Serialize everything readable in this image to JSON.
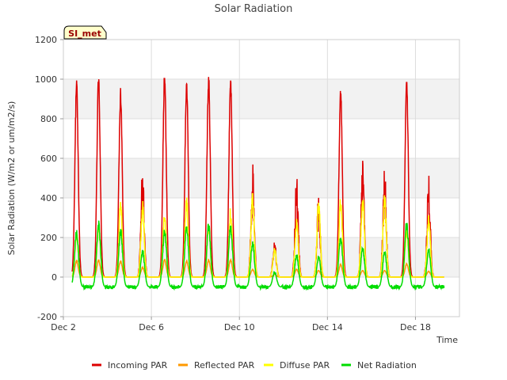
{
  "chart_data": {
    "type": "line",
    "title": "Solar Radiation",
    "site_label": "SI_met",
    "xlabel": "Time",
    "ylabel": "Solar Radiation (W/m2 or um/m2/s)",
    "xlim": [
      2.0,
      20.0
    ],
    "ylim": [
      -200,
      1200
    ],
    "yticks": [
      -200,
      0,
      200,
      400,
      600,
      800,
      1000,
      1200
    ],
    "xticks": [
      {
        "day": 2,
        "label": "Dec 2"
      },
      {
        "day": 6,
        "label": "Dec 6"
      },
      {
        "day": 10,
        "label": "Dec 10"
      },
      {
        "day": 14,
        "label": "Dec 14"
      },
      {
        "day": 18,
        "label": "Dec 18"
      }
    ],
    "grid": true,
    "legend_position": "bottom",
    "days": [
      {
        "peak_day": 2.6,
        "incoming": 1010,
        "reflected": 85,
        "diffuse": 240,
        "net": 245
      },
      {
        "peak_day": 3.6,
        "incoming": 1040,
        "reflected": 90,
        "diffuse": 280,
        "net": 290
      },
      {
        "peak_day": 4.6,
        "incoming": 960,
        "reflected": 85,
        "diffuse": 410,
        "net": 250
      },
      {
        "peak_day": 5.6,
        "incoming": 590,
        "reflected": 50,
        "diffuse": 390,
        "net": 145
      },
      {
        "peak_day": 6.6,
        "incoming": 1045,
        "reflected": 90,
        "diffuse": 360,
        "net": 250
      },
      {
        "peak_day": 7.6,
        "incoming": 1000,
        "reflected": 85,
        "diffuse": 430,
        "net": 270
      },
      {
        "peak_day": 8.6,
        "incoming": 1035,
        "reflected": 90,
        "diffuse": 280,
        "net": 280
      },
      {
        "peak_day": 9.6,
        "incoming": 1015,
        "reflected": 90,
        "diffuse": 360,
        "net": 275
      },
      {
        "peak_day": 10.6,
        "incoming": 580,
        "reflected": 40,
        "diffuse": 440,
        "net": 185
      },
      {
        "peak_day": 11.6,
        "incoming": 185,
        "reflected": 15,
        "diffuse": 150,
        "net": 30
      },
      {
        "peak_day": 12.6,
        "incoming": 520,
        "reflected": 40,
        "diffuse": 300,
        "net": 120
      },
      {
        "peak_day": 13.6,
        "incoming": 440,
        "reflected": 35,
        "diffuse": 400,
        "net": 110
      },
      {
        "peak_day": 14.6,
        "incoming": 970,
        "reflected": 65,
        "diffuse": 420,
        "net": 215
      },
      {
        "peak_day": 15.6,
        "incoming": 590,
        "reflected": 35,
        "diffuse": 430,
        "net": 160
      },
      {
        "peak_day": 16.6,
        "incoming": 570,
        "reflected": 35,
        "diffuse": 420,
        "net": 140
      },
      {
        "peak_day": 17.6,
        "incoming": 1010,
        "reflected": 70,
        "diffuse": 260,
        "net": 290
      },
      {
        "peak_day": 18.6,
        "incoming": 520,
        "reflected": 30,
        "diffuse": 320,
        "net": 150
      }
    ],
    "night_net": -50,
    "series": [
      {
        "name": "Incoming PAR",
        "key": "incoming",
        "color": "#dd0000"
      },
      {
        "name": "Reflected PAR",
        "key": "reflected",
        "color": "#ff9900"
      },
      {
        "name": "Diffuse PAR",
        "key": "diffuse",
        "color": "#ffff00"
      },
      {
        "name": "Net Radiation",
        "key": "net",
        "color": "#00dd00"
      }
    ]
  }
}
